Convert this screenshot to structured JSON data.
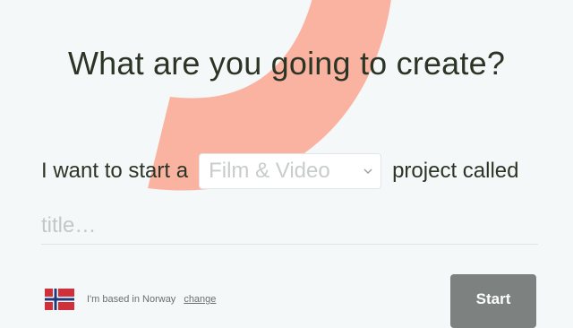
{
  "headline": "What are you going to create?",
  "sentence": {
    "prefix": "I want to start a",
    "category_value": "Film & Video",
    "suffix": "project called"
  },
  "title_input": {
    "placeholder": "title…",
    "value": ""
  },
  "location": {
    "text": "I'm based in Norway",
    "change_label": "change",
    "flag_icon": "norway-flag-icon"
  },
  "start_button": {
    "label": "Start"
  },
  "colors": {
    "background": "#f5f8f8",
    "accent_arc": "#fbb3a1",
    "text": "#2b3526",
    "button": "#7d8180"
  }
}
